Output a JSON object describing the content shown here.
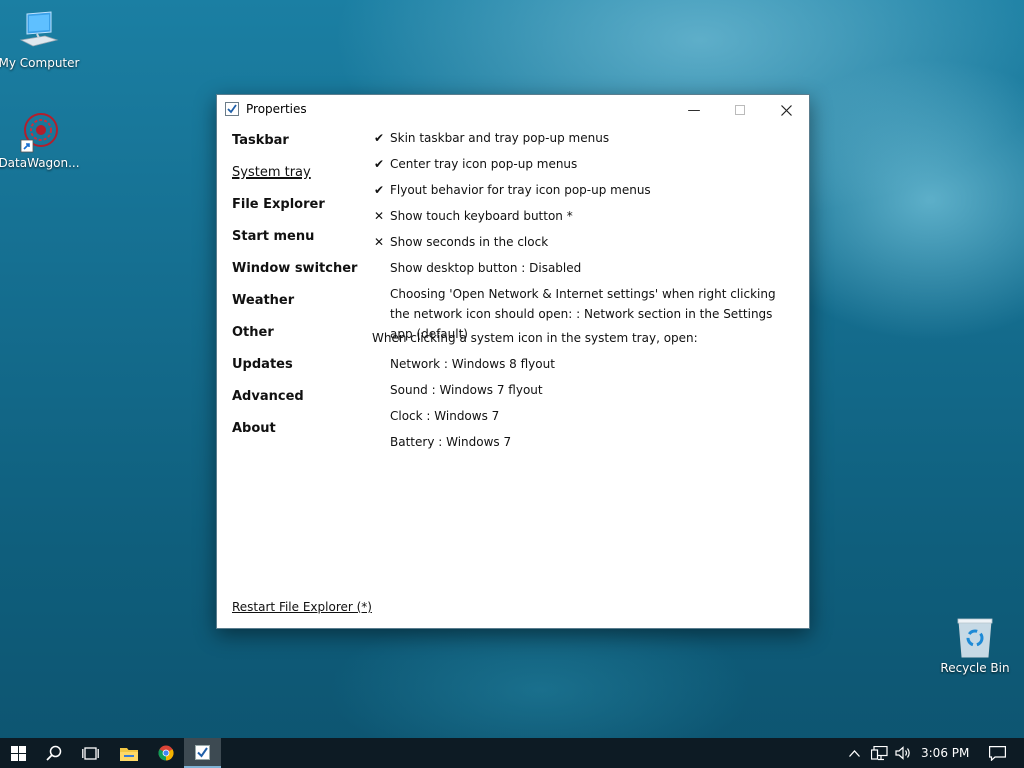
{
  "desktop": {
    "icons": [
      {
        "label": "My Computer"
      },
      {
        "label": "DataWagon..."
      },
      {
        "label": "Recycle Bin"
      }
    ]
  },
  "window": {
    "title": "Properties",
    "nav": [
      "Taskbar",
      "System tray",
      "File Explorer",
      "Start menu",
      "Window switcher",
      "Weather",
      "Other",
      "Updates",
      "Advanced",
      "About"
    ],
    "active_nav": "System tray",
    "options": [
      {
        "mark": "✔",
        "text": "Skin taskbar and tray pop-up menus"
      },
      {
        "mark": "✔",
        "text": "Center tray icon pop-up menus"
      },
      {
        "mark": "✔",
        "text": "Flyout behavior for tray icon pop-up menus"
      },
      {
        "mark": "✕",
        "text": "Show touch keyboard button *"
      },
      {
        "mark": "✕",
        "text": "Show seconds in the clock"
      },
      {
        "mark": "",
        "text": "Show desktop button : Disabled"
      },
      {
        "mark": "",
        "text": "Choosing 'Open Network & Internet settings' when right clicking the network icon should open: : Network section in the Settings app (default)"
      }
    ],
    "section_heading": "When clicking a system icon in the system tray, open:",
    "sub_options": [
      "Network : Windows 8 flyout",
      "Sound : Windows 7 flyout",
      "Clock : Windows 7",
      "Battery : Windows 7"
    ],
    "restart_link": "Restart File Explorer (*)"
  },
  "taskbar": {
    "clock": "3:06 PM",
    "icons": [
      "start-icon",
      "search-icon",
      "task-view-icon",
      "file-explorer-icon",
      "chrome-icon",
      "properties-app-icon"
    ],
    "tray_icons": [
      "chevron-up-icon",
      "network-icon",
      "volume-icon",
      "action-center-icon"
    ]
  },
  "colors": {
    "taskbar": "#0d1b24",
    "accent": "#7fb3d5"
  }
}
